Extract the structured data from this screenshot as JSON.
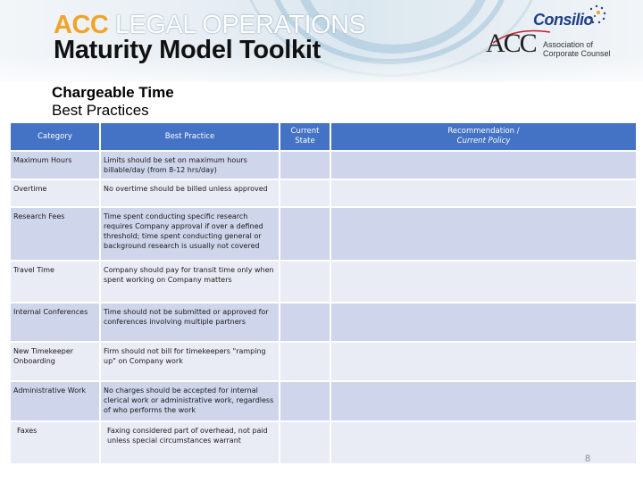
{
  "header": {
    "brand_prefix": "ACC",
    "brand_line1_rest": " LEGAL OPERATIONS",
    "brand_line2": "Maturity Model Toolkit",
    "partner_logo": "Consilio",
    "org_logo": "ACC",
    "org_name_line1": "Association of",
    "org_name_line2": "Corporate Counsel"
  },
  "title": {
    "line1": "Chargeable Time",
    "line2": "Best Practices"
  },
  "table": {
    "columns": {
      "category": "Category",
      "best_practice": "Best Practice",
      "current_state_line1": "Current",
      "current_state_line2": "State",
      "recommendation_line1": "Recommendation /",
      "recommendation_line2": "Current Policy"
    },
    "rows": [
      {
        "category": "Maximum Hours",
        "practice": "Limits should be set on maximum hours billable/day (from 8-12 hrs/day)",
        "state": "",
        "recommendation": ""
      },
      {
        "category": "Overtime",
        "practice": "No overtime should be billed unless approved",
        "state": "",
        "recommendation": ""
      },
      {
        "category": "Research Fees",
        "practice": "Time spent conducting specific research requires Company approval if over a defined threshold; time spent conducting general or background research is usually not covered",
        "state": "",
        "recommendation": ""
      },
      {
        "category": "Travel Time",
        "practice": "Company should pay for transit time only when spent working on Company matters",
        "state": "",
        "recommendation": ""
      },
      {
        "category": "Internal Conferences",
        "practice": "Time should not be submitted or approved for conferences involving multiple partners",
        "state": "",
        "recommendation": ""
      },
      {
        "category": "New Timekeeper Onboarding",
        "practice": "Firm should not bill for timekeepers \"ramping up\" on Company work",
        "state": "",
        "recommendation": ""
      },
      {
        "category": "Administrative Work",
        "practice": "No charges should be accepted for internal clerical work or administrative work, regardless of who performs the work",
        "state": "",
        "recommendation": ""
      },
      {
        "category": "Faxes",
        "practice": "Faxing considered part of overhead, not paid unless special circumstances warrant",
        "state": "",
        "recommendation": ""
      }
    ]
  },
  "colors": {
    "header_fill": "#4472c4",
    "row_dark": "#cfd5ea",
    "row_light": "#e9ebf5",
    "brand_accent": "#f0a42a",
    "consilio_blue": "#1f3f87"
  },
  "page_number": "8"
}
